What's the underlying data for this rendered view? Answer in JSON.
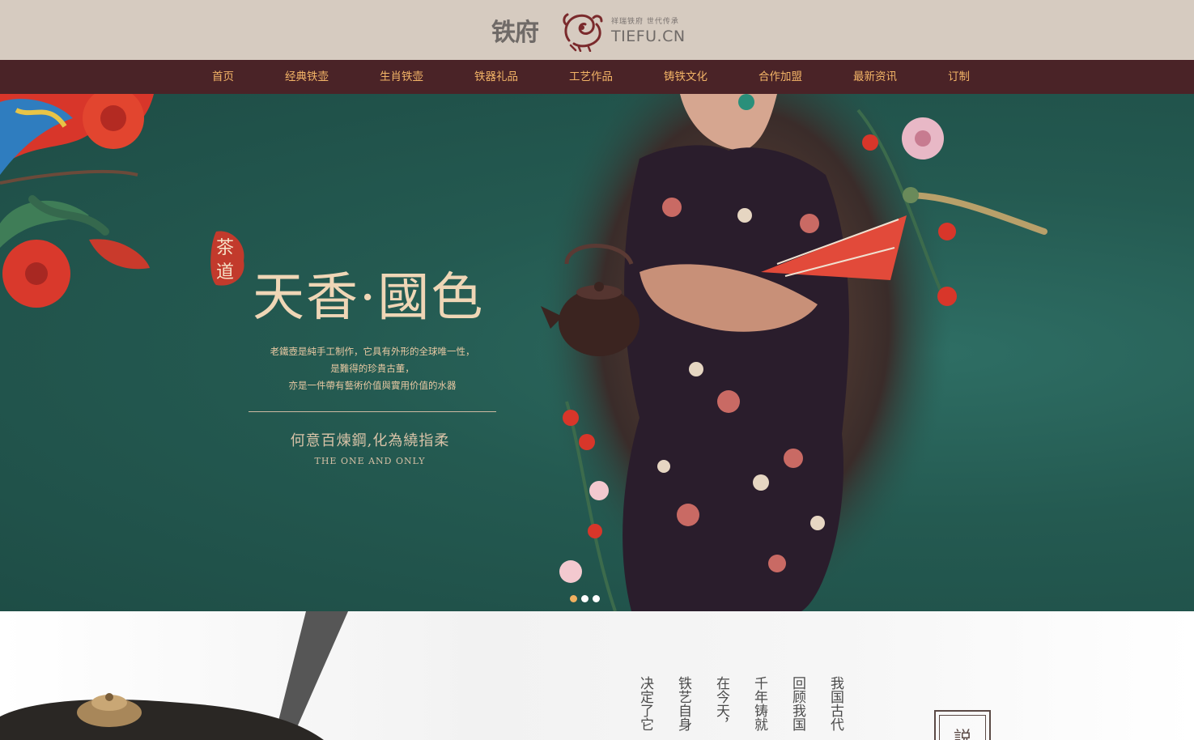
{
  "header": {
    "logo_cn": "铁府",
    "logo_slogan": "祥瑞铁府 世代传承",
    "logo_en": "TIEFU.CN"
  },
  "nav": {
    "items": [
      {
        "label": "首页"
      },
      {
        "label": "经典铁壶"
      },
      {
        "label": "生肖铁壶"
      },
      {
        "label": "铁器礼品"
      },
      {
        "label": "工艺作品"
      },
      {
        "label": "铸铁文化"
      },
      {
        "label": "合作加盟"
      },
      {
        "label": "最新资讯"
      },
      {
        "label": "订制"
      }
    ]
  },
  "banner": {
    "seal_top": "茶",
    "seal_bottom": "道",
    "title": "天香·國色",
    "desc_lines": [
      "老鐵壺是純手工制作，它具有外形的全球唯一性，",
      "是難得的珍貴古董，",
      "亦是一件帶有藝術价值與實用价值的水器"
    ],
    "motto": "何意百煉鋼,化為繞指柔",
    "motto_en": "THE ONE AND ONLY",
    "slides": 3,
    "active_slide": 1,
    "colors": {
      "bg": "#245a51",
      "title": "#efd6b6",
      "accent": "#f0b060"
    }
  },
  "lower": {
    "columns": [
      "我国古代",
      "回顾我国",
      "千年铸就",
      "在今天，",
      "铁艺自身",
      "决定了它"
    ],
    "stamp": "説"
  },
  "colors": {
    "header_bg": "#d6cbc0",
    "nav_bg": "#4a2327",
    "nav_text": "#f3b467"
  }
}
